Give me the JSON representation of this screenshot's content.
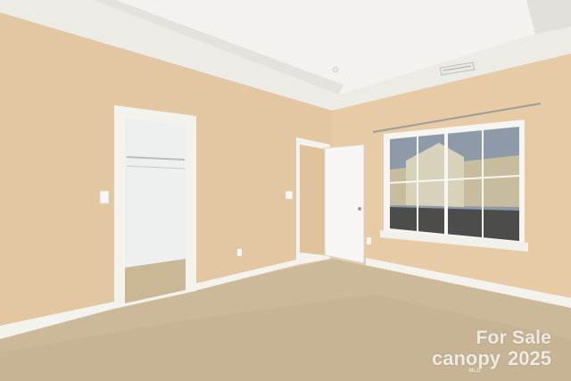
{
  "scene": {
    "description_type": "real-estate listing photo",
    "colors": {
      "wall": "#e2c7a2",
      "wall_right": "#e6cba6",
      "ceiling": "#ecebe6",
      "carpet": "#cbb99a",
      "trim": "#f4f2ec",
      "window_glass": "#8e9aa8"
    },
    "icons": [
      "light-switch-icon",
      "outlet-icon",
      "air-vent-icon",
      "curtain-rod-icon"
    ]
  },
  "watermark": {
    "line1": "For Sale",
    "brand": "canopy",
    "year": "2025",
    "sub": "MLS"
  }
}
